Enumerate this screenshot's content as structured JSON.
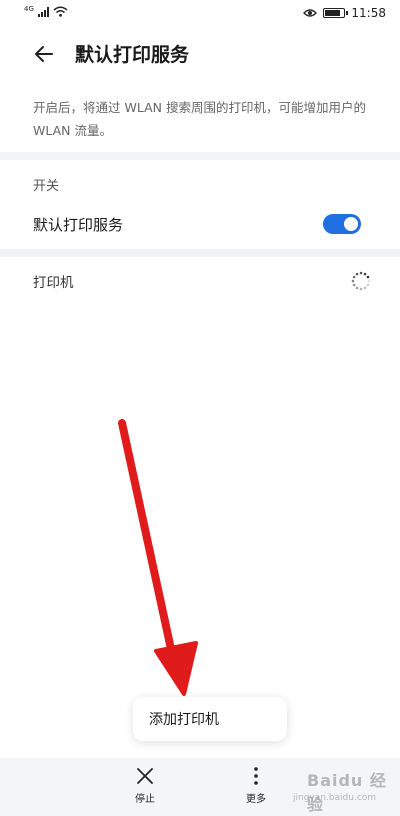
{
  "status_bar": {
    "network_type": "4G",
    "wifi_icon": "wifi-icon",
    "eye_icon": "eye-comfort-icon",
    "battery_level": 0.85,
    "time": "11:58"
  },
  "header": {
    "title": "默认打印服务",
    "back_icon": "back-arrow-icon"
  },
  "description": "开启后，将通过 WLAN 搜索周围的打印机，可能增加用户的 WLAN 流量。",
  "switch_section": {
    "label": "开关",
    "row_title": "默认打印服务",
    "toggle_on": true,
    "toggle_color": "#1f6fe0"
  },
  "printers_section": {
    "label": "打印机",
    "loading_icon": "loading-spinner-icon"
  },
  "annotation": {
    "arrow_color": "#e01b1b"
  },
  "popup_menu": {
    "items": [
      "添加打印机"
    ]
  },
  "bottom_bar": {
    "stop_label": "停止",
    "more_label": "更多"
  },
  "watermark": {
    "main": "Baidu 经验",
    "sub": "jingyan.baidu.com"
  }
}
